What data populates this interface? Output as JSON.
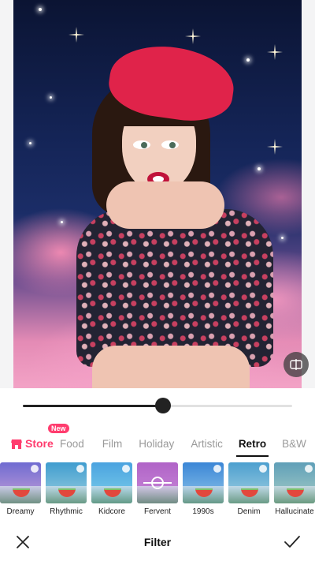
{
  "slider": {
    "value": 0.52
  },
  "tabs": [
    {
      "label": "Store",
      "badge": "New",
      "active": false
    },
    {
      "label": "Food",
      "active": false
    },
    {
      "label": "Film",
      "active": false
    },
    {
      "label": "Holiday",
      "active": false
    },
    {
      "label": "Artistic",
      "active": false
    },
    {
      "label": "Retro",
      "active": true
    },
    {
      "label": "B&W",
      "active": false
    }
  ],
  "filters": [
    {
      "label": "Dreamy",
      "colors": [
        "#6f6bd1",
        "#c7a0d8"
      ]
    },
    {
      "label": "Rhythmic",
      "colors": [
        "#3f9ccf",
        "#9dd0e0"
      ]
    },
    {
      "label": "Kidcore",
      "colors": [
        "#4aa3e0",
        "#7fd0ea"
      ]
    },
    {
      "label": "Fervent",
      "colors": [
        "#b063c7",
        "#c98ad8"
      ],
      "selected": true
    },
    {
      "label": "1990s",
      "colors": [
        "#3b86d6",
        "#8fc6ea"
      ]
    },
    {
      "label": "Denim",
      "colors": [
        "#4c9fcf",
        "#a5d2e2"
      ]
    },
    {
      "label": "Hallucinate",
      "colors": [
        "#5f9fb8",
        "#a9cfc7"
      ]
    }
  ],
  "bottom_bar": {
    "title": "Filter"
  },
  "colors": {
    "accent": "#ff3c6e",
    "text": "#111111"
  }
}
